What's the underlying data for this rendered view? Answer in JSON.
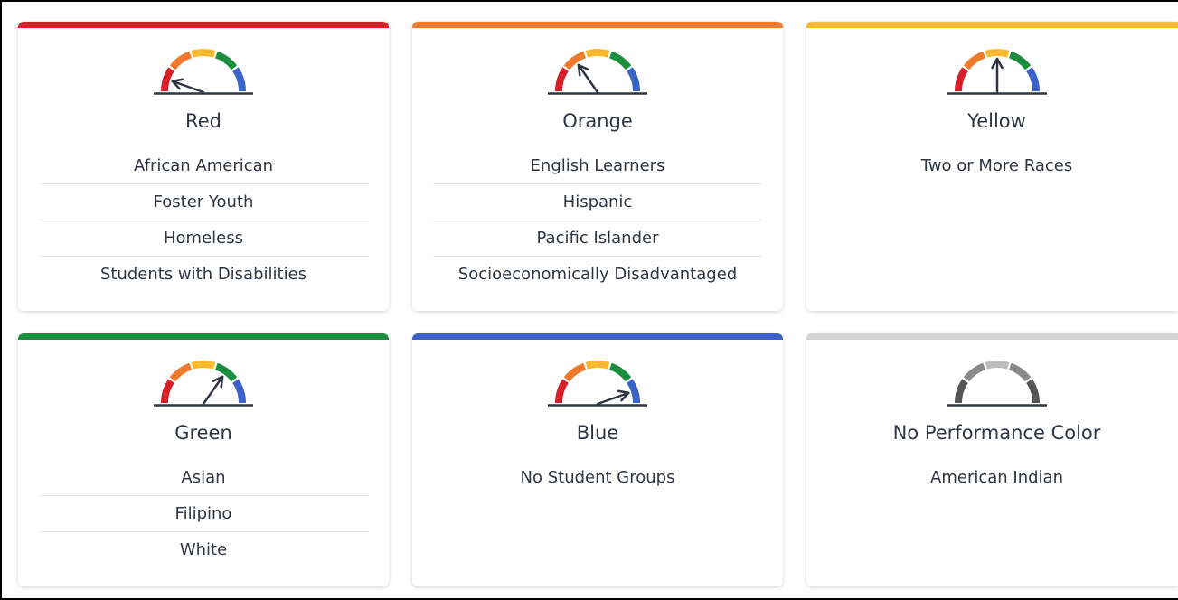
{
  "cards": [
    {
      "id": "red",
      "title": "Red",
      "accent": "#d7212a",
      "needle_level": 0.1,
      "items": [
        "African American",
        "Foster Youth",
        "Homeless",
        "Students with Disabilities"
      ]
    },
    {
      "id": "orange",
      "title": "Orange",
      "accent": "#f07a2b",
      "needle_level": 0.3,
      "items": [
        "English Learners",
        "Hispanic",
        "Pacific Islander",
        "Socioeconomically Disadvantaged"
      ]
    },
    {
      "id": "yellow",
      "title": "Yellow",
      "accent": "#fbb92f",
      "needle_level": 0.5,
      "items": [
        "Two or More Races"
      ]
    },
    {
      "id": "green",
      "title": "Green",
      "accent": "#1b8f3f",
      "needle_level": 0.7,
      "items": [
        "Asian",
        "Filipino",
        "White"
      ]
    },
    {
      "id": "blue",
      "title": "Blue",
      "accent": "#3b62c8",
      "needle_level": 0.9,
      "items": [
        "No Student Groups"
      ]
    },
    {
      "id": "none",
      "title": "No Performance Color",
      "accent": "#d4d4d4",
      "needle_level": null,
      "items": [
        "American Indian"
      ]
    }
  ],
  "gauge_colors": [
    "#d7212a",
    "#f07a2b",
    "#fbb92f",
    "#1b8f3f",
    "#3b62c8"
  ],
  "gauge_gray_colors": [
    "#555555",
    "#8a8a8a",
    "#bcbcbc",
    "#8a8a8a",
    "#555555"
  ]
}
